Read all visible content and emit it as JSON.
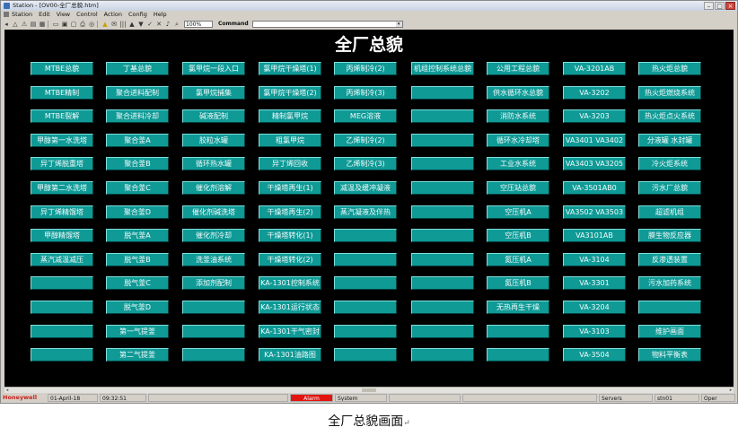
{
  "window": {
    "title": "Station - [OV00-全厂总貌.htm]",
    "menu": [
      "Station",
      "Edit",
      "View",
      "Control",
      "Action",
      "Config",
      "Help"
    ],
    "zoom": "100%",
    "command_label": "Command"
  },
  "page_title": "全厂总貌",
  "columns": [
    [
      "MTBE总貌",
      "MTBE精制",
      "MTBE裂解",
      "甲醇第一水洗塔",
      "异丁烯脱重塔",
      "甲醇第二水洗塔",
      "异丁烯精馏塔",
      "甲醇精馏塔",
      "蒸汽减温减压",
      "",
      "",
      "",
      ""
    ],
    [
      "丁基总貌",
      "聚合进料配制",
      "聚合进料冷却",
      "聚合釜A",
      "聚合釜B",
      "聚合釜C",
      "聚合釜D",
      "脱气釜A",
      "脱气釜B",
      "脱气釜C",
      "脱气釜D",
      "第一气提釜",
      "第二气提釜"
    ],
    [
      "氯甲烷一段入口",
      "氯甲烷捕集",
      "碱液配制",
      "胶粒水罐",
      "循环热水罐",
      "催化剂溶解",
      "催化剂碱洗塔",
      "催化剂冷却",
      "洗釜油系统",
      "添加剂配制",
      "",
      "",
      ""
    ],
    [
      "氯甲烷干燥塔(1)",
      "氯甲烷干燥塔(2)",
      "精制氯甲烷",
      "粗氯甲烷",
      "异丁烯回收",
      "干燥塔再生(1)",
      "干燥塔再生(2)",
      "干燥塔转化(1)",
      "干燥塔转化(2)",
      "KA-1301控制系统",
      "KA-1301运行状态",
      "KA-1301干气密封",
      "KA-1301油路图"
    ],
    [
      "丙烯制冷(2)",
      "丙烯制冷(3)",
      "MEG溶液",
      "乙烯制冷(2)",
      "乙烯制冷(3)",
      "减温及缓冲凝液",
      "蒸汽凝液及伴热",
      "",
      "",
      "",
      "",
      "",
      ""
    ],
    [
      "机组控制系统总貌",
      "",
      "",
      "",
      "",
      "",
      "",
      "",
      "",
      "",
      "",
      "",
      ""
    ],
    [
      "公用工程总貌",
      "供水循环水总貌",
      "消防水系统",
      "循环水冷却塔",
      "工业水系统",
      "空压站总貌",
      "空压机A",
      "空压机B",
      "氮压机A",
      "氮压机B",
      "无热再生干燥",
      "",
      ""
    ],
    [
      "VA-3201AB",
      "VA-3202",
      "VA-3203",
      "VA3401 VA3402",
      "VA3403 VA3205",
      "VA-3501AB0",
      "VA3502 VA3503",
      "VA3101AB",
      "VA-3104",
      "VA-3301",
      "VA-3204",
      "VA-3103",
      "VA-3504"
    ],
    [
      "热火炬总貌",
      "热火炬燃烧系统",
      "热火炬点火系统",
      "分液罐 水封罐",
      "冷火炬系统",
      "污水厂总貌",
      "超滤机组",
      "膜生物反应器",
      "反渗透装置",
      "污水加药系统",
      "",
      "维护画面",
      "物料平衡表"
    ]
  ],
  "status": {
    "brand": "Honeywell",
    "date": "01-April-18",
    "time": "09:32:51",
    "alarm_label": "Alarm",
    "system_label": "System",
    "servers_label": "Servers",
    "station": "stn01",
    "mode": "Oper"
  },
  "caption": "全厂总貌画面",
  "caption_mark": "↵",
  "colors": {
    "button_fill": "#0f9a96",
    "screen_bg": "#000000",
    "alarm": "#e2140f",
    "brand": "#c8231c"
  }
}
